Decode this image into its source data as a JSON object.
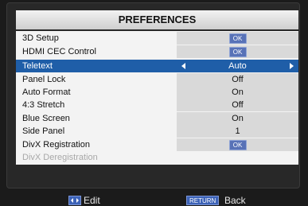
{
  "menu": {
    "title": "PREFERENCES",
    "items": [
      {
        "label": "3D Setup",
        "value": "",
        "button": "OK"
      },
      {
        "label": "HDMI CEC Control",
        "value": "",
        "button": "OK"
      },
      {
        "label": "Teletext",
        "value": "Auto",
        "button": "",
        "selected": true
      },
      {
        "label": "Panel Lock",
        "value": "Off",
        "button": ""
      },
      {
        "label": "Auto Format",
        "value": "On",
        "button": ""
      },
      {
        "label": "4:3 Stretch",
        "value": "Off",
        "button": ""
      },
      {
        "label": "Blue Screen",
        "value": "On",
        "button": ""
      },
      {
        "label": "Side Panel",
        "value": "1",
        "button": ""
      },
      {
        "label": "DivX Registration",
        "value": "",
        "button": "OK"
      },
      {
        "label": "DivX Deregistration",
        "value": "",
        "button": "",
        "disabled": true
      }
    ]
  },
  "footer": {
    "edit_label": "Edit",
    "return_key": "RETURN",
    "back_label": "Back"
  },
  "colors": {
    "selected_row": "#1f5ea8",
    "ok_button": "#5872b7",
    "value_column": "#d9d9d9"
  },
  "icons": {
    "edit": "left-right-arrows-icon",
    "selector_left": "arrow-left-icon",
    "selector_right": "arrow-right-icon"
  }
}
